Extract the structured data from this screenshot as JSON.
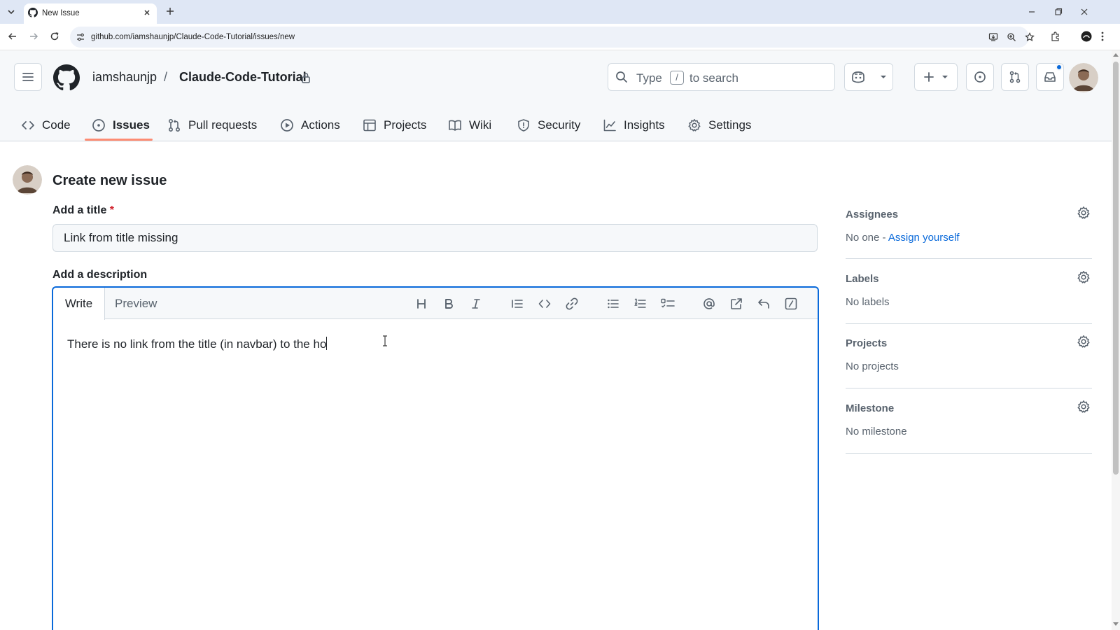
{
  "browser": {
    "tab_title": "New Issue",
    "url": "github.com/iamshaunjp/Claude-Code-Tutorial/issues/new"
  },
  "header": {
    "owner": "iamshaunjp",
    "separator": "/",
    "repo": "Claude-Code-Tutorial",
    "search": {
      "prefix": "Type",
      "key": "/",
      "suffix": "to search"
    }
  },
  "nav": {
    "items": [
      {
        "label": "Code",
        "icon": "code-icon"
      },
      {
        "label": "Issues",
        "icon": "issue-icon",
        "active": true
      },
      {
        "label": "Pull requests",
        "icon": "pull-request-icon"
      },
      {
        "label": "Actions",
        "icon": "play-icon"
      },
      {
        "label": "Projects",
        "icon": "table-icon"
      },
      {
        "label": "Wiki",
        "icon": "book-icon"
      },
      {
        "label": "Security",
        "icon": "shield-icon"
      },
      {
        "label": "Insights",
        "icon": "graph-icon"
      },
      {
        "label": "Settings",
        "icon": "gear-icon"
      }
    ]
  },
  "main": {
    "heading": "Create new issue",
    "title_label": "Add a title",
    "required_mark": "*",
    "title_value": "Link from title missing",
    "description_label": "Add a description",
    "editor_tabs": {
      "write": "Write",
      "preview": "Preview"
    },
    "description_value": "There is no link from the title (in navbar) to the ho"
  },
  "sidebar": {
    "assignees": {
      "title": "Assignees",
      "value": "No one - ",
      "link": "Assign yourself"
    },
    "labels": {
      "title": "Labels",
      "value": "No labels"
    },
    "projects": {
      "title": "Projects",
      "value": "No projects"
    },
    "milestone": {
      "title": "Milestone",
      "value": "No milestone"
    }
  },
  "colors": {
    "accent": "#0969da",
    "active_tab_underline": "#fd8c73",
    "required": "#d1242f"
  }
}
